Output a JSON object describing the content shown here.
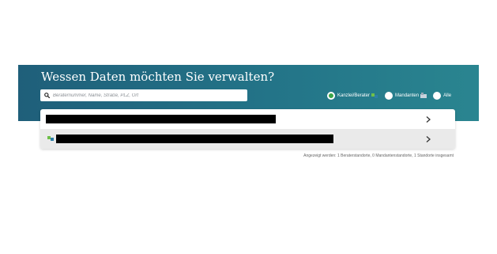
{
  "header": {
    "title": "Wessen Daten möchten Sie verwalten?"
  },
  "search": {
    "placeholder": "Beraternummer, Name, Straße, PLZ, Ort",
    "value": "",
    "icon": "search-icon"
  },
  "filter": {
    "options": [
      {
        "label": "Kanzlei/Berater",
        "selected": true,
        "icon": "advisor-icon"
      },
      {
        "label": "Mandanten",
        "selected": false,
        "icon": "client-icon"
      },
      {
        "label": "Alle",
        "selected": false,
        "icon": ""
      }
    ]
  },
  "results": {
    "rows": [
      {
        "name": "",
        "redacted": true,
        "icon": "",
        "chevron": "chevron-right-icon"
      },
      {
        "name": "",
        "redacted": true,
        "icon": "advisor-icon",
        "chevron": "chevron-right-icon"
      }
    ]
  },
  "status": {
    "text": "Angezeigt werden: 1 Beraterstandorte, 0 Mandantenstandorte, 1 Standorte insgesamt"
  },
  "colors": {
    "banner_start": "#1f5f7a",
    "banner_end": "#2a8590",
    "selected_radio": "#3aa548",
    "row_alt": "#eaeaea"
  }
}
